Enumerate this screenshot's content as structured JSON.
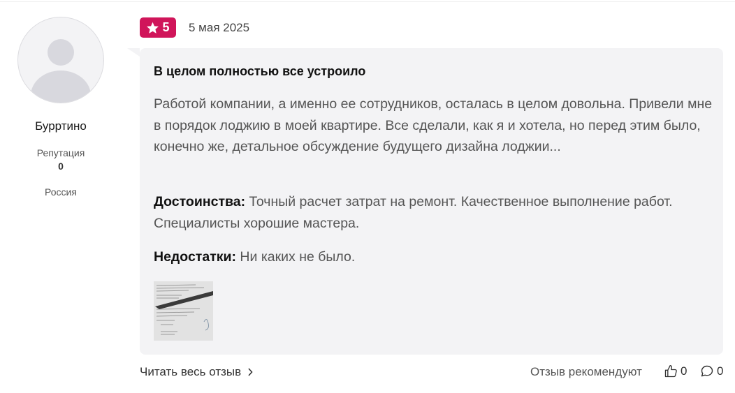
{
  "user": {
    "name": "Бурртино",
    "reputation_label": "Репутация",
    "reputation_value": "0",
    "country": "Россия"
  },
  "review": {
    "rating": "5",
    "date": "5 мая 2025",
    "title": "В целом полностью все устроило",
    "text": "Работой компании, а именно ее сотрудников, осталась в целом довольна. Привели мне в порядок лоджию в моей квартире. Все сделали, как я и хотела, но перед этим было, конечно же, детальное обсуждение будущего дизайна лоджии...",
    "pros_label": "Достоинства:",
    "pros_text": "Точный расчет затрат на ремонт. Качественное выполнение работ. Специалисты хорошие мастера.",
    "cons_label": "Недостатки:",
    "cons_text": "Ни каких не было."
  },
  "footer": {
    "read_more": "Читать весь отзыв",
    "recommend_label": "Отзыв рекомендуют",
    "likes_count": "0",
    "comments_count": "0"
  },
  "colors": {
    "rating_badge": "#d0155a",
    "bubble_bg": "#f3f3f5"
  },
  "icons": [
    "star-icon",
    "chevron-right-icon",
    "thumbs-up-icon",
    "comment-icon"
  ]
}
